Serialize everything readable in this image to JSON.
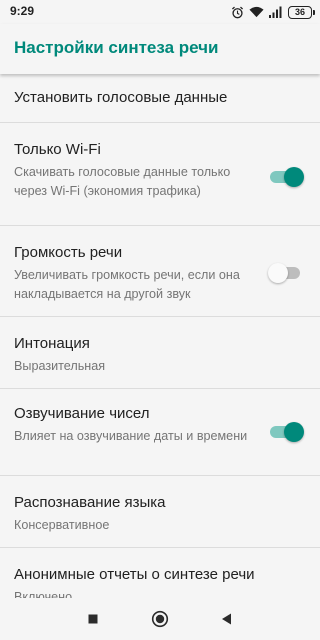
{
  "status_bar": {
    "time": "9:29",
    "battery": "36",
    "icons": [
      "alarm-icon",
      "wifi-icon",
      "signal-icon",
      "battery-icon"
    ]
  },
  "app_bar": {
    "title": "Настройки синтеза речи"
  },
  "settings": [
    {
      "title": "Установить голосовые данные",
      "summary": null,
      "toggle": null
    },
    {
      "title": "Только Wi-Fi",
      "summary": "Скачивать голосовые данные только через Wi-Fi (экономия трафика)",
      "toggle": true
    },
    {
      "title": "Громкость речи",
      "summary": "Увеличивать громкость речи, если она накладывается на другой звук",
      "toggle": false
    },
    {
      "title": "Интонация",
      "summary": "Выразительная",
      "toggle": null
    },
    {
      "title": "Озвучивание чисел",
      "summary": "Влияет на озвучивание даты и времени",
      "toggle": true
    },
    {
      "title": "Распознавание языка",
      "summary": "Консервативное",
      "toggle": null
    },
    {
      "title": "Анонимные отчеты о синтезе речи",
      "summary": "Включено",
      "toggle": null
    }
  ],
  "colors": {
    "accent": "#00897b",
    "toggle_on_track": "#7fc8bf",
    "toggle_off_track": "#bdbdbd",
    "background": "#f5f5f5"
  },
  "nav_bar": {
    "buttons": [
      "recents-square-icon",
      "home-circle-icon",
      "back-triangle-icon"
    ]
  }
}
